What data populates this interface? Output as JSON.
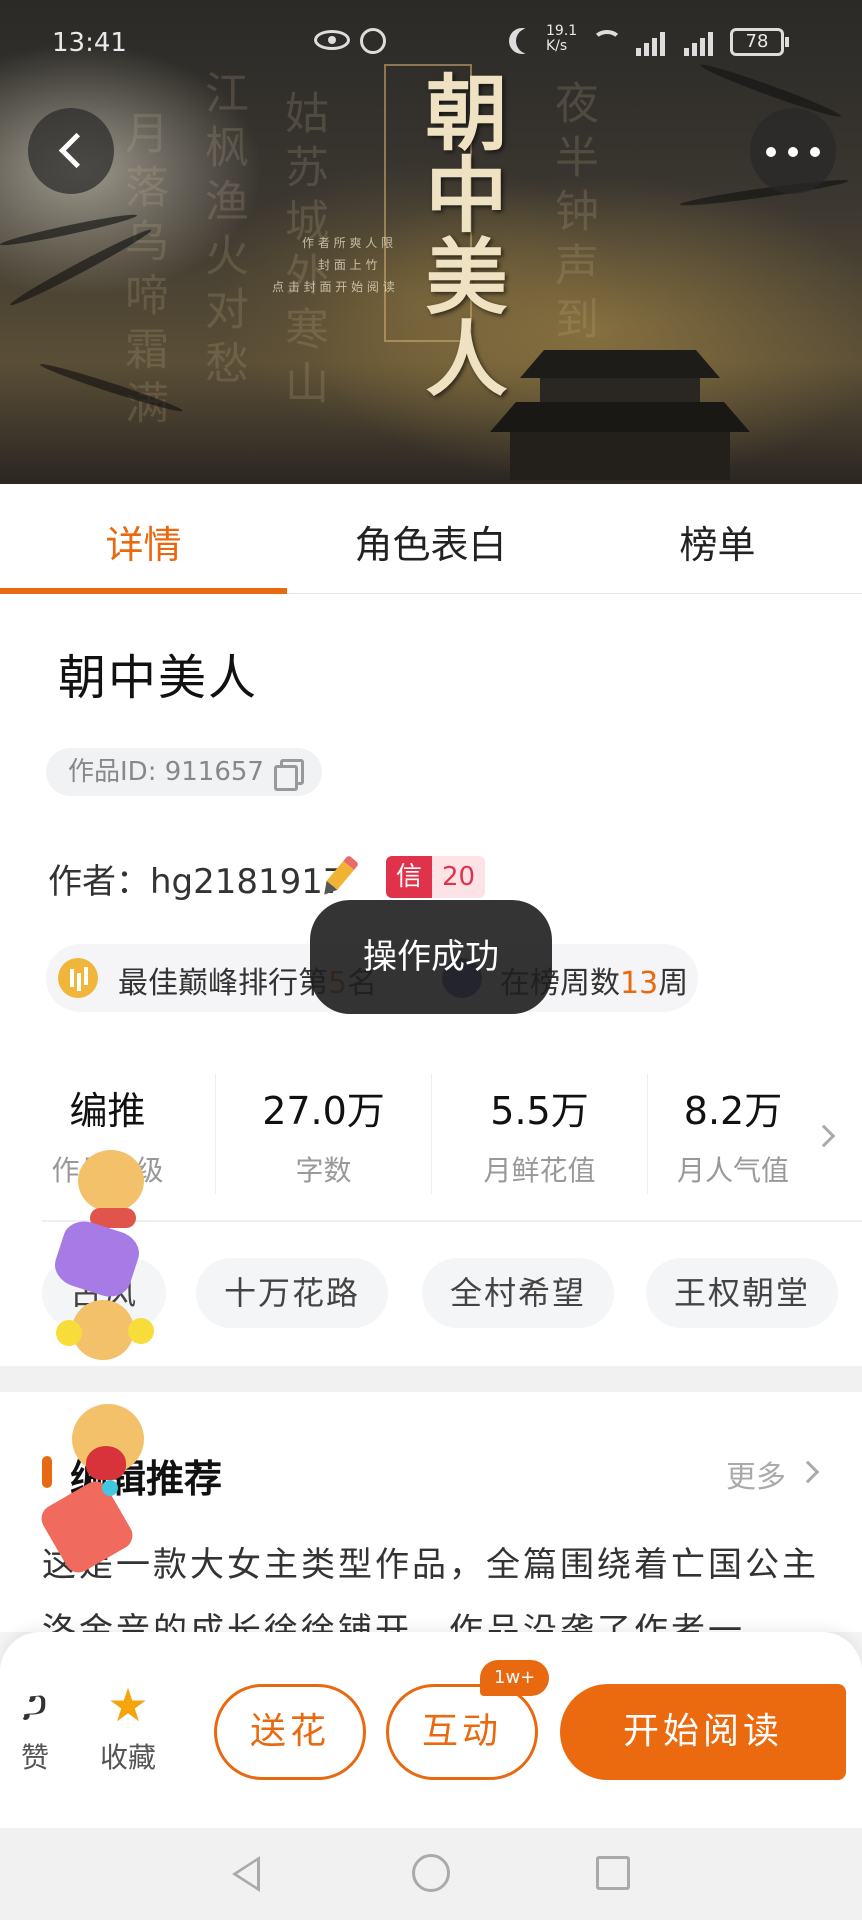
{
  "status_bar": {
    "time": "13:41",
    "net_speed": "19.1\nK/s",
    "battery": "78"
  },
  "cover": {
    "title_art": "朝中美人",
    "credit_lines": [
      "作 者 所 爽 人 限",
      "封 面 上 竹",
      "点 击 封 面 开 始 阅 读"
    ]
  },
  "tabs": [
    {
      "label": "详情",
      "active": true
    },
    {
      "label": "角色表白",
      "active": false
    },
    {
      "label": "榜单",
      "active": false
    }
  ],
  "book": {
    "title": "朝中美人",
    "work_id": "作品ID: 911657",
    "author": "作者：hg2181917",
    "xin_label": "信",
    "xin_value": "20",
    "rank_prefix": "最佳巅峰排行第",
    "rank_value": "5",
    "rank_suffix": "名",
    "weeks_prefix": "在榜周数",
    "weeks_value": "13",
    "weeks_suffix": "周"
  },
  "toast": "操作成功",
  "stats": [
    {
      "value": "编推",
      "label": "作品等级"
    },
    {
      "value": "27.0万",
      "label": "字数"
    },
    {
      "value": "5.5万",
      "label": "月鲜花值"
    },
    {
      "value": "8.2万",
      "label": "月人气值"
    }
  ],
  "tags": [
    "古风",
    "十万花路",
    "全村希望",
    "王权朝堂"
  ],
  "recommend": {
    "title": "编辑推荐",
    "more": "更多",
    "body": "这是一款大女主类型作品，全篇围绕着亡国公主洛金音的成长徐徐铺开，作品沿袭了作者一"
  },
  "actions": {
    "like_label": "赞",
    "fav_label": "收藏",
    "flower_label": "送花",
    "interact_label": "互动",
    "interact_badge": "1w+",
    "read_label": "开始阅读"
  },
  "colors": {
    "accent": "#e8690f",
    "star": "#f7a40b",
    "xin_red": "#e0334b"
  }
}
